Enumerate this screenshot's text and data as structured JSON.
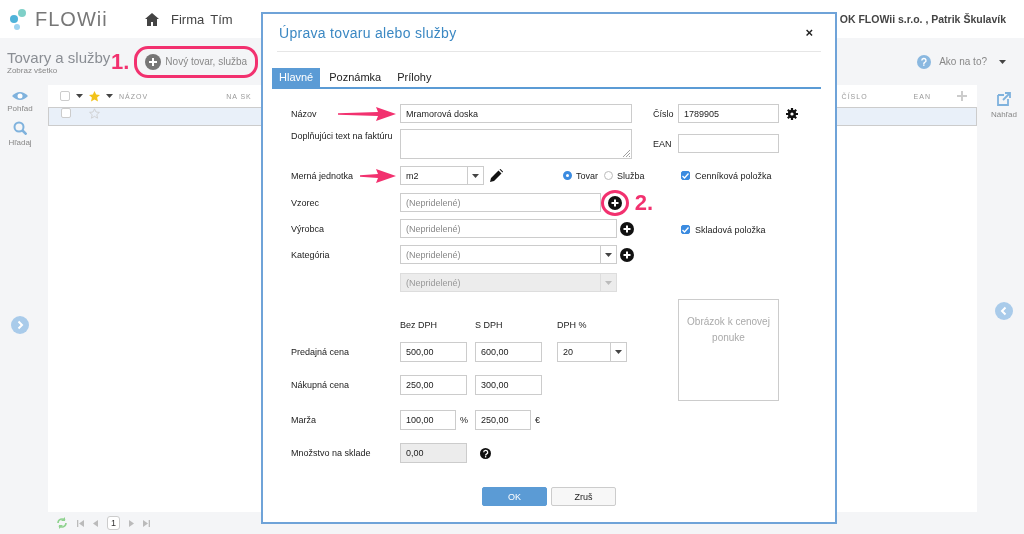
{
  "app": {
    "logo": "FLOWii",
    "nav": [
      "Firma",
      "Tím"
    ],
    "account": "OK FLOWii s.r.o. , Patrik Škulavík",
    "page_title": "Tovary a služby",
    "page_subtitle": "Zobraz všetko",
    "new_button": {
      "label": "Nový tovar, služba",
      "circled": true,
      "callout": "1."
    },
    "help": "Ako na to?",
    "left_tools": [
      {
        "label": "Pohľad",
        "kind": "eye"
      },
      {
        "label": "Hľadaj",
        "kind": "search"
      }
    ],
    "right_tools": [
      {
        "label": "Náhľad",
        "kind": "external"
      }
    ],
    "columns_left": [
      "NÁZOV",
      "NA SK"
    ],
    "columns_right": [
      "ČÍSLO",
      "EAN"
    ],
    "select_all": {
      "checked": false
    },
    "rows": [
      {
        "selected": true,
        "checked": false
      }
    ],
    "page": "1"
  },
  "dialog": {
    "title": "Úprava tovaru alebo služby",
    "close": "×",
    "tabs": [
      {
        "label": "Hlavné",
        "selected": true
      },
      {
        "label": "Poznámka",
        "selected": false
      },
      {
        "label": "Prílohy",
        "selected": false
      }
    ],
    "name": {
      "label": "Názov",
      "value": "Mramorová doska",
      "arrow": true
    },
    "note": {
      "label": "Doplňujúci text na faktúru"
    },
    "unit": {
      "label": "Merná jednotka",
      "value": "m2",
      "arrow": true
    },
    "type_options": [
      {
        "label": "Tovar",
        "selected": true
      },
      {
        "label": "Služba",
        "selected": false
      }
    ],
    "lookups": [
      {
        "label": "Vzorec",
        "placeholder": "(Nepridelené)",
        "kind": "field",
        "disabled": false,
        "circled": true,
        "callout": "2."
      },
      {
        "label": "Výrobca",
        "placeholder": "(Nepridelené)",
        "kind": "field",
        "disabled": false,
        "circled": false
      },
      {
        "label": "Kategória",
        "placeholder": "(Nepridelené)",
        "kind": "select",
        "disabled": false,
        "circled": false
      },
      {
        "placeholder": "(Nepridelené)",
        "kind": "select",
        "disabled": true
      }
    ],
    "price_headers": [
      "Bez DPH",
      "S DPH",
      "DPH %"
    ],
    "price_rows": [
      {
        "label": "Predajná cena",
        "values": [
          "500,00",
          "600,00"
        ],
        "vat": "20"
      },
      {
        "label": "Nákupná cena",
        "values": [
          "250,00",
          "300,00"
        ]
      }
    ],
    "margin": {
      "label": "Marža",
      "values": [
        {
          "value": "100,00",
          "unit": "%"
        },
        {
          "value": "250,00",
          "unit": "€"
        }
      ]
    },
    "stock": {
      "label": "Množstvo na sklade",
      "value": "0,00"
    },
    "number": {
      "label": "Číslo",
      "value": "1789905"
    },
    "ean": {
      "label": "EAN"
    },
    "flags": [
      {
        "label": "Cenníková položka",
        "checked": true
      },
      {
        "label": "Skladová položka",
        "checked": true
      }
    ],
    "image_placeholder": "Obrázok k cenovej ponuke",
    "buttons": [
      {
        "label": "OK",
        "primary": true
      },
      {
        "label": "Zruš",
        "primary": false
      }
    ]
  }
}
